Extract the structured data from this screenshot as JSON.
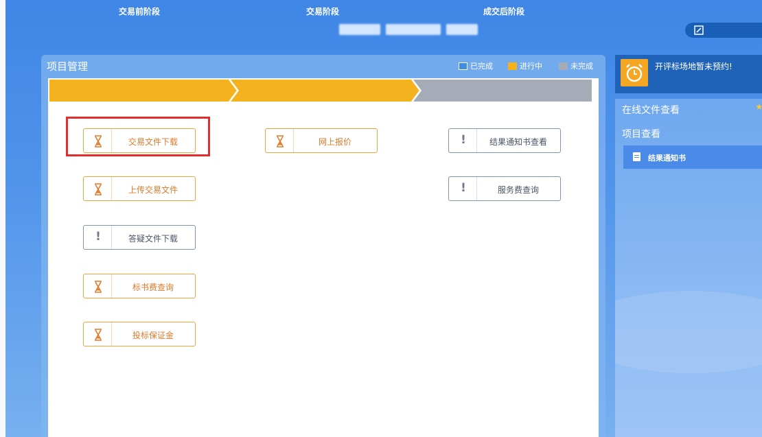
{
  "project_panel": {
    "title": "项目管理",
    "legend": [
      {
        "label": "已完成",
        "color": "#3e8ee6"
      },
      {
        "label": "进行中",
        "color": "#f4b21f"
      },
      {
        "label": "未完成",
        "color": "#a5acb8"
      }
    ]
  },
  "stages": [
    {
      "label": "交易前阶段",
      "status": "in-progress",
      "color": "#f4b21f"
    },
    {
      "label": "交易阶段",
      "status": "in-progress",
      "color": "#f4b21f"
    },
    {
      "label": "成交后阶段",
      "status": "not-completed",
      "color": "#a5acb8"
    }
  ],
  "actions": {
    "download_trade_file": {
      "label": "交易文件下载",
      "status": "in-progress",
      "icon": "hourglass-icon",
      "highlighted": true
    },
    "upload_trade_file": {
      "label": "上传交易文件",
      "status": "in-progress",
      "icon": "hourglass-icon"
    },
    "download_qa_file": {
      "label": "答疑文件下载",
      "status": "not-completed",
      "icon": "exclamation-icon"
    },
    "bid_fee_query": {
      "label": "标书费查询",
      "status": "in-progress",
      "icon": "hourglass-icon"
    },
    "bid_bond": {
      "label": "投标保证金",
      "status": "in-progress",
      "icon": "hourglass-icon"
    },
    "online_quote": {
      "label": "网上报价",
      "status": "in-progress",
      "icon": "hourglass-icon"
    },
    "result_notice_view": {
      "label": "结果通知书查看",
      "status": "not-completed",
      "icon": "exclamation-icon"
    },
    "service_fee_query": {
      "label": "服务费查询",
      "status": "not-completed",
      "icon": "exclamation-icon"
    }
  },
  "notice": {
    "text": "开评标场地暂未预约!",
    "icon": "alarm-clock-icon"
  },
  "sidebar": {
    "online_file_view": "在线文件查看",
    "project_view": "项目查看",
    "items": [
      {
        "label": "结果通知书",
        "icon": "document-icon"
      }
    ]
  },
  "header": {
    "edit_icon": "edit-icon"
  }
}
